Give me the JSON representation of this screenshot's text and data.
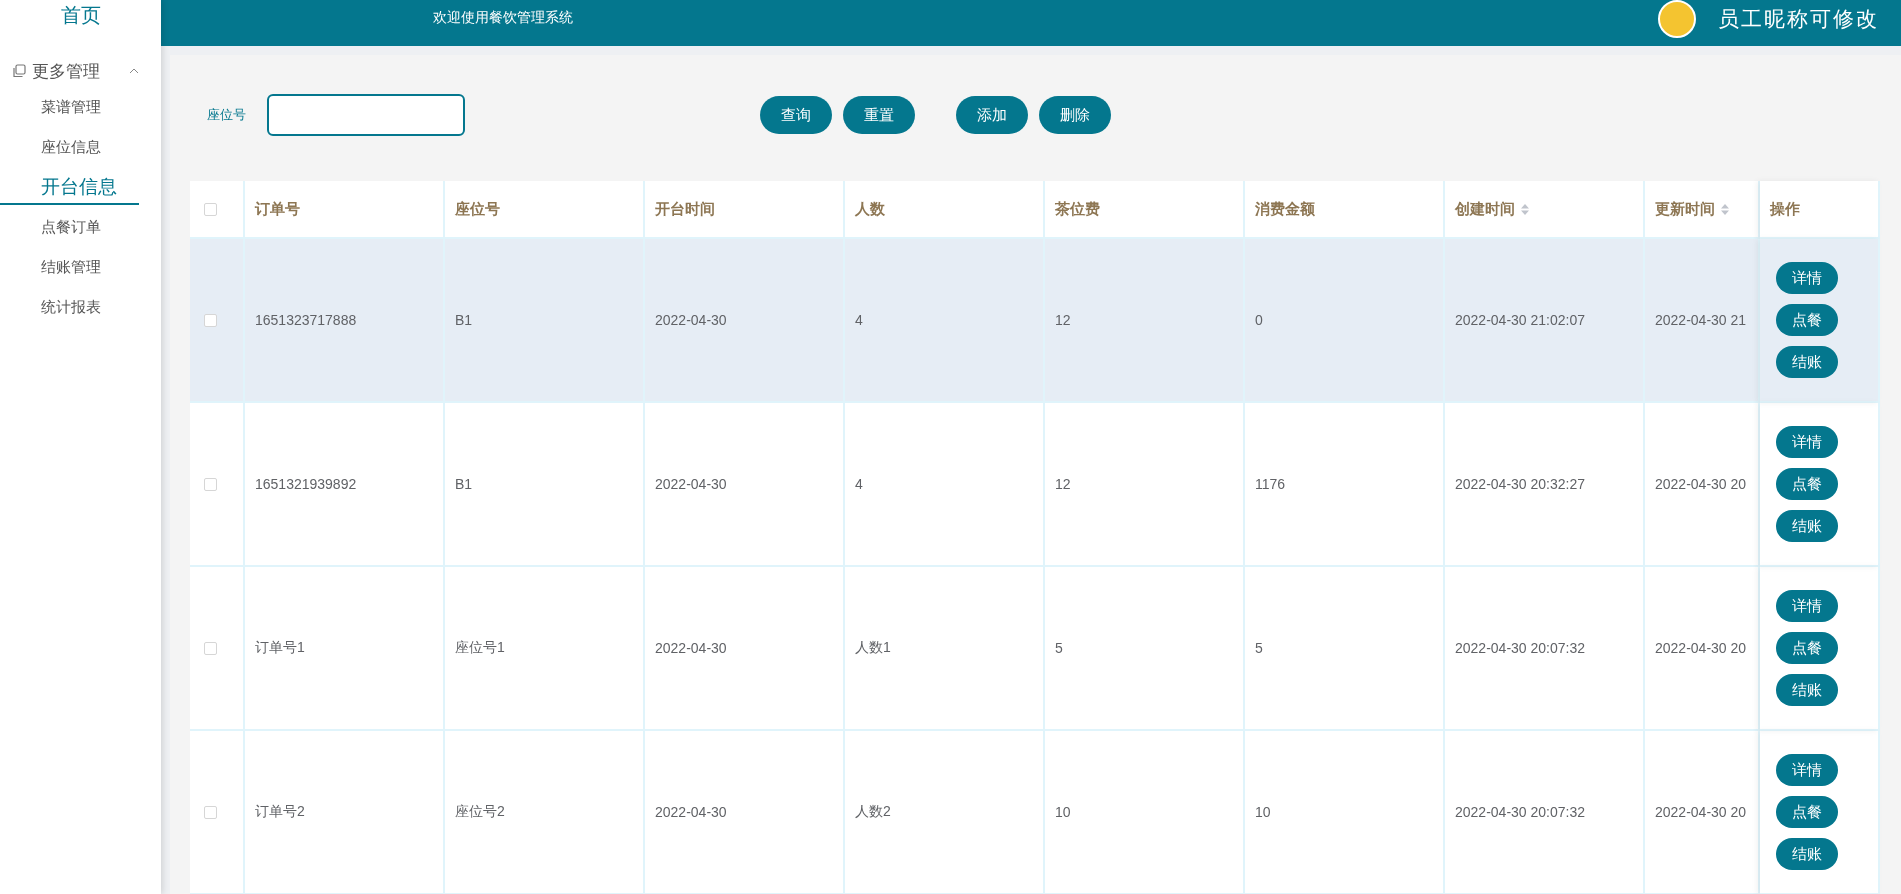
{
  "sidebar": {
    "home": "首页",
    "groups": [
      {
        "label": "更多管理",
        "expanded": true,
        "items": [
          {
            "label": "菜谱管理",
            "selected": false
          },
          {
            "label": "座位信息",
            "selected": false
          },
          {
            "label": "开台信息",
            "selected": true
          },
          {
            "label": "点餐订单",
            "selected": false
          },
          {
            "label": "结账管理",
            "selected": false
          },
          {
            "label": "统计报表",
            "selected": false
          }
        ]
      }
    ]
  },
  "header": {
    "title": "欢迎使用餐饮管理系统",
    "user_name": "员工昵称可修改"
  },
  "search": {
    "label": "座位号"
  },
  "toolbar": [
    "查询",
    "重置",
    "添加",
    "删除"
  ],
  "table": {
    "select_all_checked": false,
    "columns": [
      {
        "label": "订单号",
        "sortable": false
      },
      {
        "label": "座位号",
        "sortable": false
      },
      {
        "label": "开台时间",
        "sortable": false
      },
      {
        "label": "人数",
        "sortable": false
      },
      {
        "label": "茶位费",
        "sortable": false
      },
      {
        "label": "消费金额",
        "sortable": false
      },
      {
        "label": "创建时间",
        "sortable": true
      },
      {
        "label": "更新时间",
        "sortable": true
      },
      {
        "label": "操作",
        "sortable": false
      }
    ],
    "rows": [
      {
        "checked": false,
        "highlighted": true,
        "cells": [
          "1651323717888",
          "B1",
          "2022-04-30",
          "4",
          "12",
          "0",
          "2022-04-30 21:02:07",
          "2022-04-30 21"
        ],
        "actions": [
          "详情",
          "点餐",
          "结账"
        ]
      },
      {
        "checked": false,
        "highlighted": false,
        "cells": [
          "1651321939892",
          "B1",
          "2022-04-30",
          "4",
          "12",
          "1176",
          "2022-04-30 20:32:27",
          "2022-04-30 20"
        ],
        "actions": [
          "详情",
          "点餐",
          "结账"
        ]
      },
      {
        "checked": false,
        "highlighted": false,
        "cells": [
          "订单号1",
          "座位号1",
          "2022-04-30",
          "人数1",
          "5",
          "5",
          "2022-04-30 20:07:32",
          "2022-04-30 20"
        ],
        "actions": [
          "详情",
          "点餐",
          "结账"
        ]
      },
      {
        "checked": false,
        "highlighted": false,
        "cells": [
          "订单号2",
          "座位号2",
          "2022-04-30",
          "人数2",
          "10",
          "10",
          "2022-04-30 20:07:32",
          "2022-04-30 20"
        ],
        "actions": [
          "详情",
          "点餐",
          "结账"
        ]
      }
    ]
  }
}
